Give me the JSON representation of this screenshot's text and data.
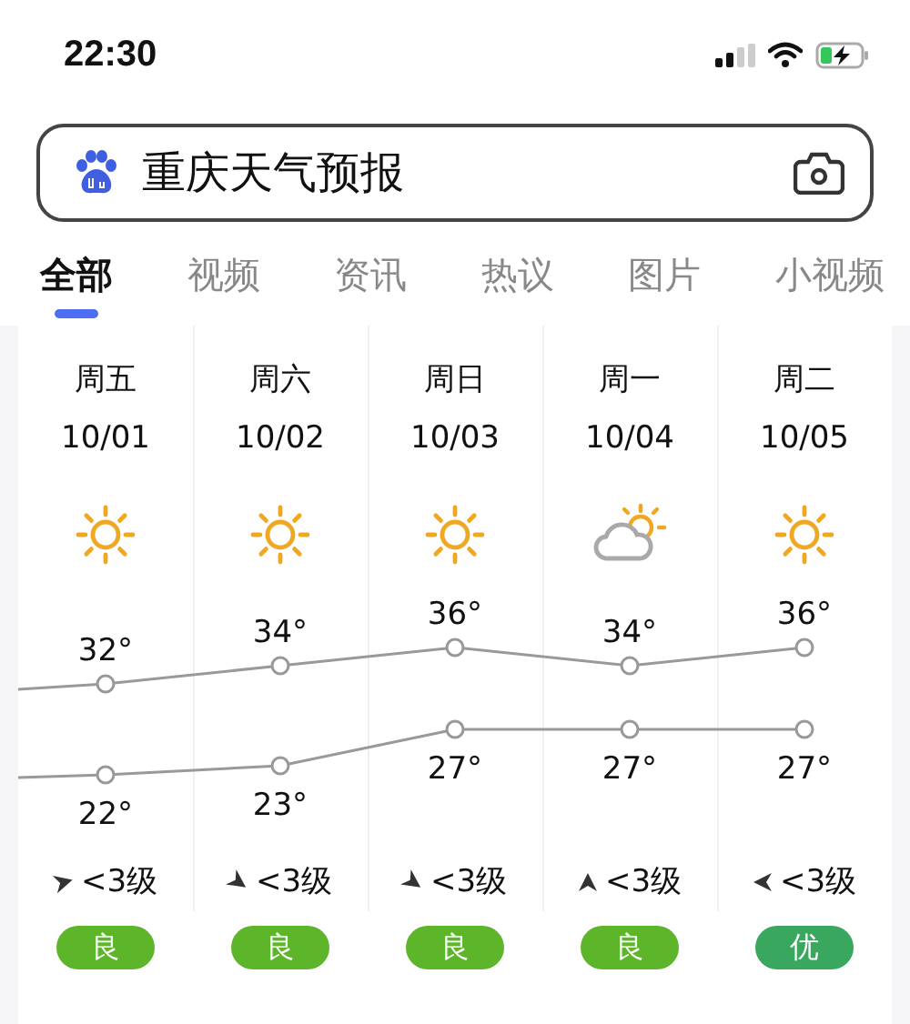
{
  "status_bar": {
    "time": "22:30"
  },
  "search": {
    "value": "重庆天气预报"
  },
  "tabs": [
    {
      "label": "全部",
      "selected": true
    },
    {
      "label": "视频",
      "selected": false
    },
    {
      "label": "资讯",
      "selected": false
    },
    {
      "label": "热议",
      "selected": false
    },
    {
      "label": "图片",
      "selected": false
    },
    {
      "label": "小视频",
      "selected": false
    }
  ],
  "days": [
    {
      "weekday": "周五",
      "weather": {
        "kind": "sunny"
      },
      "wind": {
        "kind": "east",
        "text": "<3级"
      },
      "air": {
        "label": "良",
        "color": "#5db52a"
      }
    },
    {
      "weekday": "周六",
      "weather": {
        "kind": "sunny"
      },
      "wind": {
        "kind": "southeast",
        "text": "<3级"
      },
      "air": {
        "label": "良",
        "color": "#5db52a"
      }
    },
    {
      "weekday": "周日",
      "weather": {
        "kind": "sunny"
      },
      "wind": {
        "kind": "southeast",
        "text": "<3级"
      },
      "air": {
        "label": "良",
        "color": "#5db52a"
      }
    },
    {
      "weekday": "周一",
      "weather": {
        "kind": "partly_cloudy"
      },
      "wind": {
        "kind": "north",
        "text": "<3级"
      },
      "air": {
        "label": "良",
        "color": "#5db52a"
      }
    },
    {
      "weekday": "周二",
      "weather": {
        "kind": "sunny"
      },
      "wind": {
        "kind": "west",
        "text": "<3级"
      },
      "air": {
        "label": "优",
        "color": "#3aa75f"
      }
    }
  ],
  "chart_data": {
    "type": "line",
    "categories": [
      "10/01",
      "10/02",
      "10/03",
      "10/04",
      "10/05"
    ],
    "series": [
      {
        "color": "#999999",
        "marker": "circle",
        "values": [
          32,
          34,
          36,
          34,
          36
        ],
        "value_labels": [
          "32°",
          "34°",
          "36°",
          "34°",
          "36°"
        ]
      },
      {
        "color": "#999999",
        "marker": "circle",
        "values": [
          22,
          23,
          27,
          27,
          27
        ],
        "value_labels": [
          "22°",
          "23°",
          "27°",
          "27°",
          "27°"
        ]
      }
    ]
  }
}
